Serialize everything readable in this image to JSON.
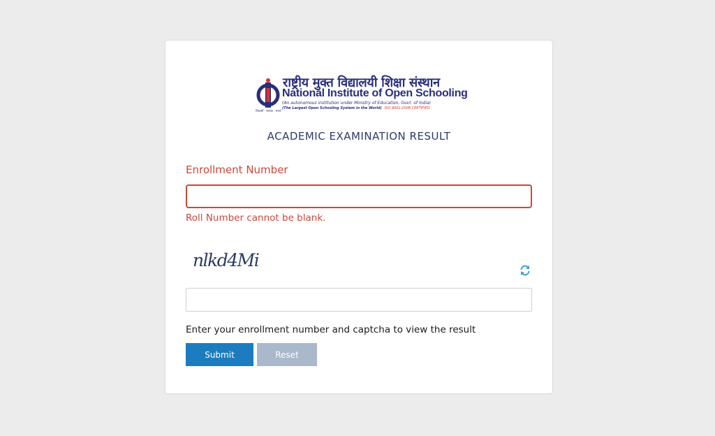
{
  "logo": {
    "hindi": "राष्ट्रीय मुक्त विद्यालयी शिक्षा संस्थान",
    "english_prefix": "National Institute of ",
    "english_bold": "Open Schooling",
    "sub1": "(An autonomous institution under Ministry of Education, Govt. of India)",
    "sub2": "(The Largest Open Schooling System in the World)",
    "iso": "ISO 9001:2008 CERTIFIED",
    "tagline": "शिक्षार्थी · सशक्त · समर्थ"
  },
  "page": {
    "title": "ACADEMIC EXAMINATION RESULT"
  },
  "form": {
    "enrollment_label": "Enrollment Number",
    "enrollment_value": "",
    "enrollment_error": "Roll Number cannot be blank.",
    "captcha_text": "nlkd4Mi",
    "captcha_value": "",
    "hint": "Enter your enrollment number and captcha to view the result",
    "submit_label": "Submit",
    "reset_label": "Reset"
  },
  "colors": {
    "brand": "#2a2e7b",
    "error": "#c9483b",
    "primary_button": "#1b7dbf",
    "reset_button": "#a9b8cb",
    "refresh_icon": "#3aa0d8"
  },
  "icons": {
    "refresh": "refresh-icon",
    "logo": "nios-logo-icon"
  }
}
